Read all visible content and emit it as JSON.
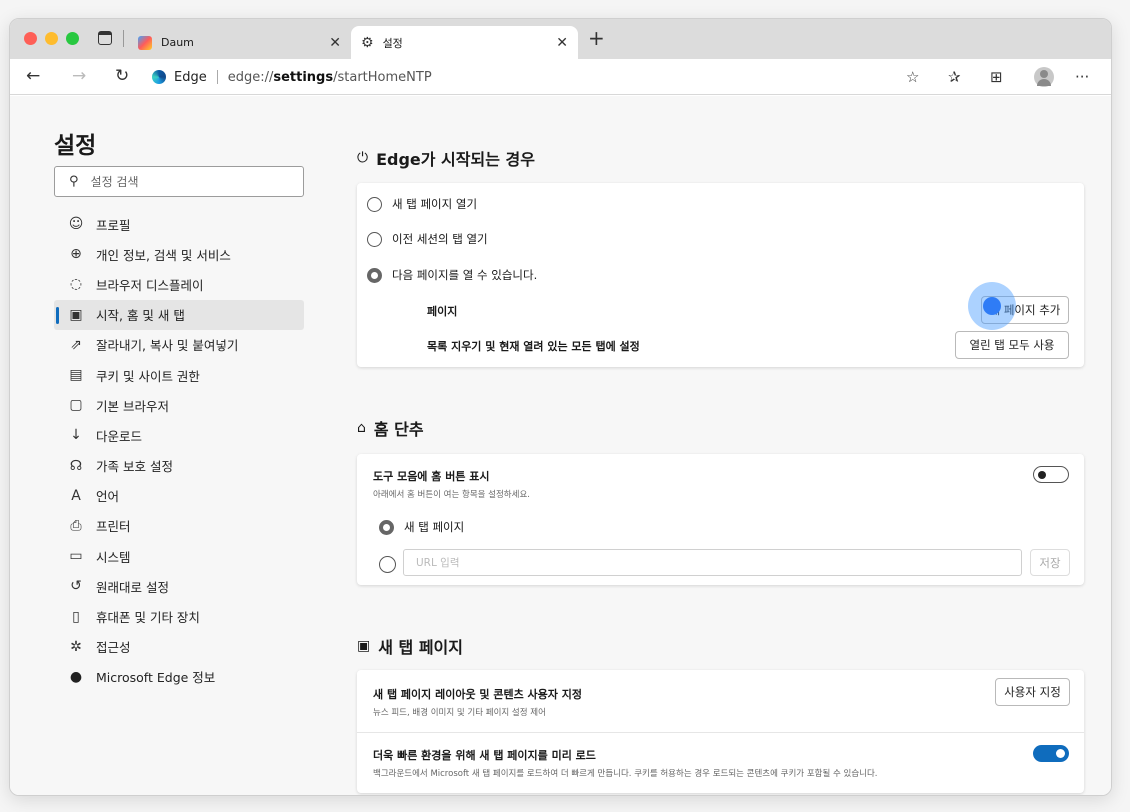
{
  "tabs": [
    {
      "title": "Daum",
      "favicon": "daum-favicon"
    },
    {
      "title": "설정",
      "favicon": "gear-icon"
    }
  ],
  "toolbar": {
    "omnibox_label": "Edge",
    "url_prefix": "edge://",
    "url_strong": "settings",
    "url_path": "/startHomeNTP"
  },
  "sidebar": {
    "title": "설정",
    "search_placeholder": "설정 검색",
    "items": [
      {
        "label": "프로필",
        "icon": "profile-icon"
      },
      {
        "label": "개인 정보, 검색 및 서비스",
        "icon": "lock-icon"
      },
      {
        "label": "브라우저 디스플레이",
        "icon": "palette-icon"
      },
      {
        "label": "시작, 홈 및 새 탭",
        "icon": "home-tab-icon",
        "active": true
      },
      {
        "label": "잘라내기, 복사 및 붙여넣기",
        "icon": "share-icon"
      },
      {
        "label": "쿠키 및 사이트 권한",
        "icon": "cookie-icon"
      },
      {
        "label": "기본 브라우저",
        "icon": "browser-icon"
      },
      {
        "label": "다운로드",
        "icon": "download-icon"
      },
      {
        "label": "가족 보호 설정",
        "icon": "family-icon"
      },
      {
        "label": "언어",
        "icon": "language-icon"
      },
      {
        "label": "프린터",
        "icon": "printer-icon"
      },
      {
        "label": "시스템",
        "icon": "system-icon"
      },
      {
        "label": "원래대로 설정",
        "icon": "reset-icon"
      },
      {
        "label": "휴대폰 및 기타 장치",
        "icon": "phone-icon"
      },
      {
        "label": "접근성",
        "icon": "accessibility-icon"
      },
      {
        "label": "Microsoft Edge 정보",
        "icon": "edge-icon"
      }
    ]
  },
  "startup": {
    "title": "Edge가 시작되는 경우",
    "options": [
      {
        "label": "새 탭 페이지 열기",
        "selected": false
      },
      {
        "label": "이전 세션의 탭 열기",
        "selected": false
      },
      {
        "label": "다음 페이지를 열 수 있습니다.",
        "selected": true
      }
    ],
    "pages_label": "페이지",
    "add_page_button": "새 페이지 추가",
    "clear_label": "목록 지우기 및 현재 열려 있는 모든 탭에 설정",
    "use_open_tabs_button": "열린 탭 모두 사용"
  },
  "home": {
    "title": "홈 단추",
    "show_button_label": "도구 모음에 홈 버튼 표시",
    "show_button_desc": "아래에서 홈 버튼이 여는 항목을 설정하세요.",
    "show_button_enabled": false,
    "option_newtab": "새 탭 페이지",
    "url_placeholder": "URL 입력",
    "save_button": "저장"
  },
  "newtab": {
    "title": "새 탭 페이지",
    "customize_title": "새 탭 페이지 레이아웃 및 콘텐츠 사용자 지정",
    "customize_desc": "뉴스 피드, 배경 이미지 및 기타 페이지 설정 제어",
    "customize_button": "사용자 지정",
    "preload_title": "더욱 빠른 환경을 위해 새 탭 페이지를 미리 로드",
    "preload_desc": "백그라운드에서 Microsoft 새 탭 페이지를 로드하여 더 빠르게 만듭니다. 쿠키를 허용하는 경우 로드되는 콘텐츠에 쿠키가 포함될 수 있습니다.",
    "preload_enabled": true
  },
  "colors": {
    "accent": "#0f6cbd",
    "cursor": "#2f7cf6"
  }
}
